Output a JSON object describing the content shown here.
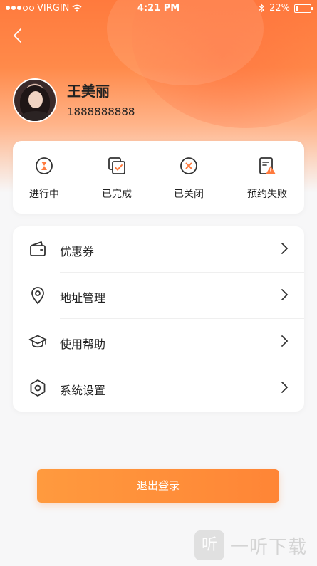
{
  "status_bar": {
    "carrier": "VIRGIN",
    "time": "4:21 PM",
    "battery": "22%",
    "battery_level": 0.22
  },
  "header": {
    "back_icon": "chevron-left-icon"
  },
  "profile": {
    "name": "王美丽",
    "phone": "1888888888"
  },
  "orders": [
    {
      "label": "进行中",
      "icon": "hourglass-icon"
    },
    {
      "label": "已完成",
      "icon": "completed-check-icon"
    },
    {
      "label": "已关闭",
      "icon": "closed-x-icon"
    },
    {
      "label": "预约失败",
      "icon": "failed-warning-icon"
    }
  ],
  "menu": [
    {
      "label": "优惠券",
      "icon": "wallet-icon"
    },
    {
      "label": "地址管理",
      "icon": "location-pin-icon"
    },
    {
      "label": "使用帮助",
      "icon": "graduation-cap-icon"
    },
    {
      "label": "系统设置",
      "icon": "settings-hex-icon"
    }
  ],
  "logout_label": "退出登录",
  "watermark": {
    "badge": "听",
    "text": "一听下载"
  },
  "colors": {
    "accent": "#ff8536",
    "icon_stroke": "#333333",
    "icon_accent": "#ff7a3d"
  }
}
